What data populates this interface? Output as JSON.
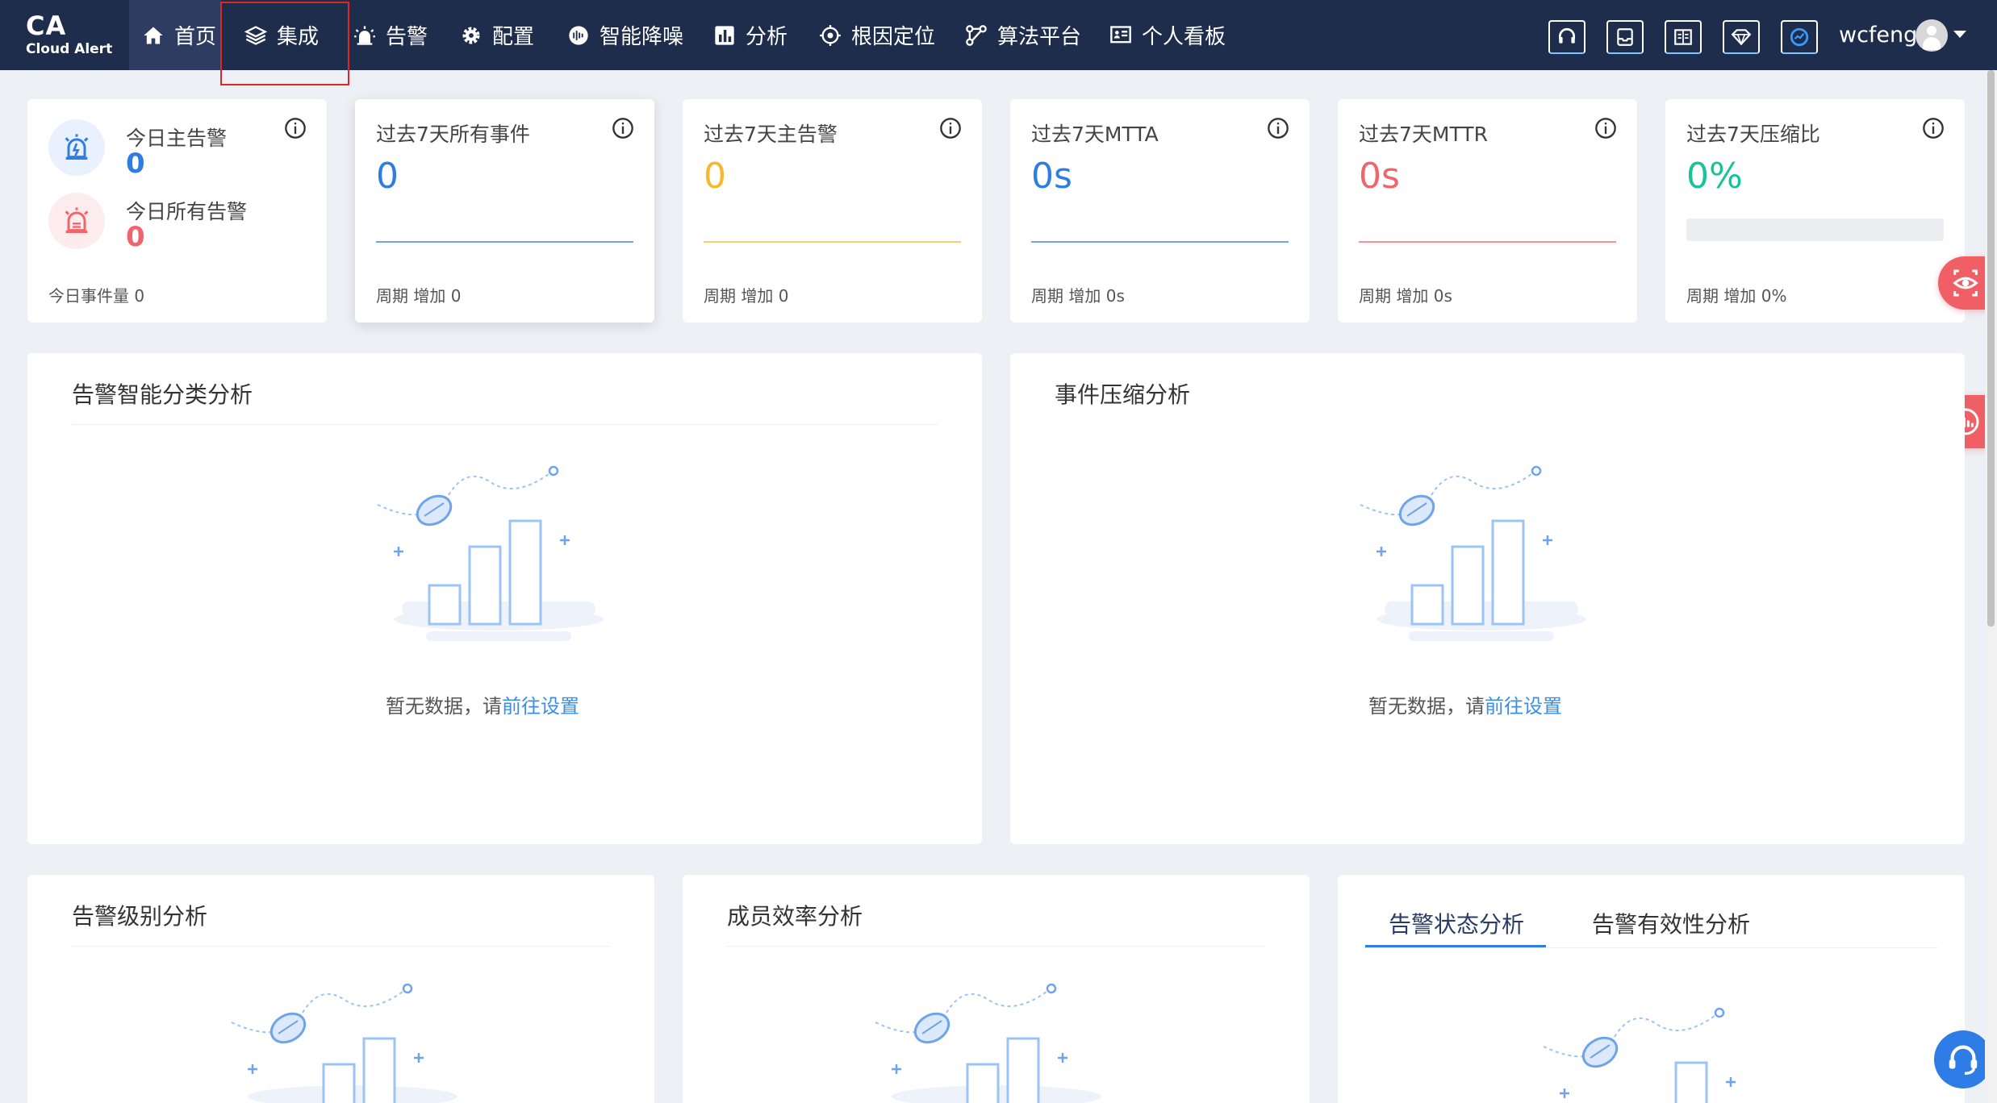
{
  "brand": {
    "title": "CA",
    "subtitle": "Cloud Alert"
  },
  "nav": {
    "items": [
      {
        "label": "首页",
        "icon": "home-icon"
      },
      {
        "label": "集成",
        "icon": "layers-icon"
      },
      {
        "label": "告警",
        "icon": "alarm-icon"
      },
      {
        "label": "配置",
        "icon": "settings-icon"
      },
      {
        "label": "智能降噪",
        "icon": "noise-reduction-icon"
      },
      {
        "label": "分析",
        "icon": "bar-chart-icon"
      },
      {
        "label": "根因定位",
        "icon": "target-icon"
      },
      {
        "label": "算法平台",
        "icon": "algorithm-icon"
      },
      {
        "label": "个人看板",
        "icon": "dashboard-icon"
      }
    ],
    "active": "首页",
    "utility_icons": [
      "support-icon",
      "inbox-icon",
      "book-icon",
      "diamond-icon",
      "speed-icon"
    ],
    "username": "wcfeng"
  },
  "today": {
    "main_label": "今日主告警",
    "main_value": "0",
    "all_label": "今日所有告警",
    "all_value": "0",
    "event_label": "今日事件量 0"
  },
  "stats": [
    {
      "title": "过去7天所有事件",
      "value": "0",
      "foot": "周期 增加 0",
      "color": "#2f7de1"
    },
    {
      "title": "过去7天主告警",
      "value": "0",
      "foot": "周期 增加 0",
      "color": "#f5b82e"
    },
    {
      "title": "过去7天MTTA",
      "value": "0s",
      "foot": "周期 增加 0s",
      "color": "#2f7de1"
    },
    {
      "title": "过去7天MTTR",
      "value": "0s",
      "foot": "周期 增加 0s",
      "color": "#f0646c"
    },
    {
      "title": "过去7天压缩比",
      "value": "0%",
      "foot": "周期 增加 0%",
      "color": "#19c39a",
      "progress": 0
    }
  ],
  "panels": {
    "classification": {
      "title": "告警智能分类分析",
      "empty_text": "暂无数据，请",
      "empty_link": "前往设置"
    },
    "compression": {
      "title": "事件压缩分析",
      "empty_text": "暂无数据，请",
      "empty_link": "前往设置"
    },
    "level": {
      "title": "告警级别分析"
    },
    "efficiency": {
      "title": "成员效率分析"
    },
    "status_tabs": [
      "告警状态分析",
      "告警有效性分析"
    ]
  },
  "colors": {
    "nav_bg": "#1f2d4d",
    "accent": "#2f7de1",
    "alert_red": "#f0646c"
  }
}
